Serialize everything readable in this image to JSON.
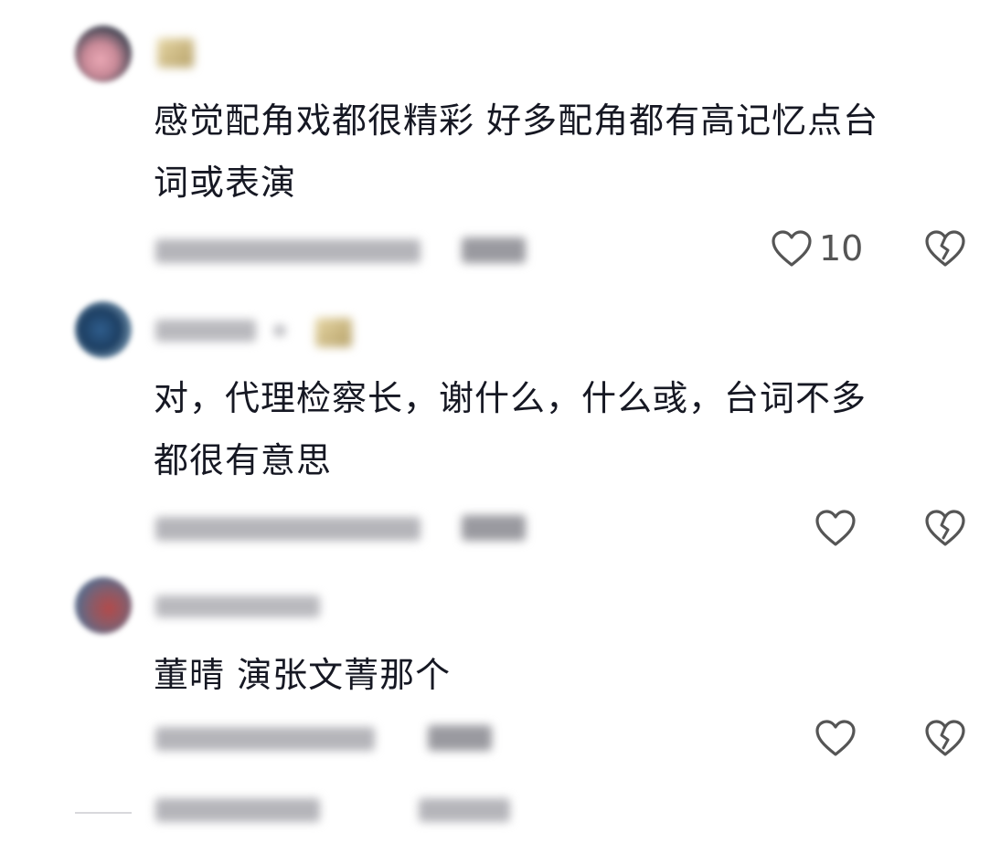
{
  "comments": [
    {
      "text_line1": "感觉配角戏都很精彩 好多配角都有高记忆点台",
      "text_line2": "词或表演",
      "like_count": "10"
    },
    {
      "text_line1": "对，代理检察长，谢什么，什么彧，台词不多",
      "text_line2": "都很有意思",
      "like_count": ""
    },
    {
      "text_line1": "董晴 演张文菁那个",
      "text_line2": "",
      "like_count": ""
    }
  ],
  "icons": {
    "like": "heart-outline-icon",
    "dislike": "broken-heart-icon"
  },
  "colors": {
    "text": "#161823",
    "icon": "#555555",
    "meta_blur": "#b5b5ba"
  }
}
